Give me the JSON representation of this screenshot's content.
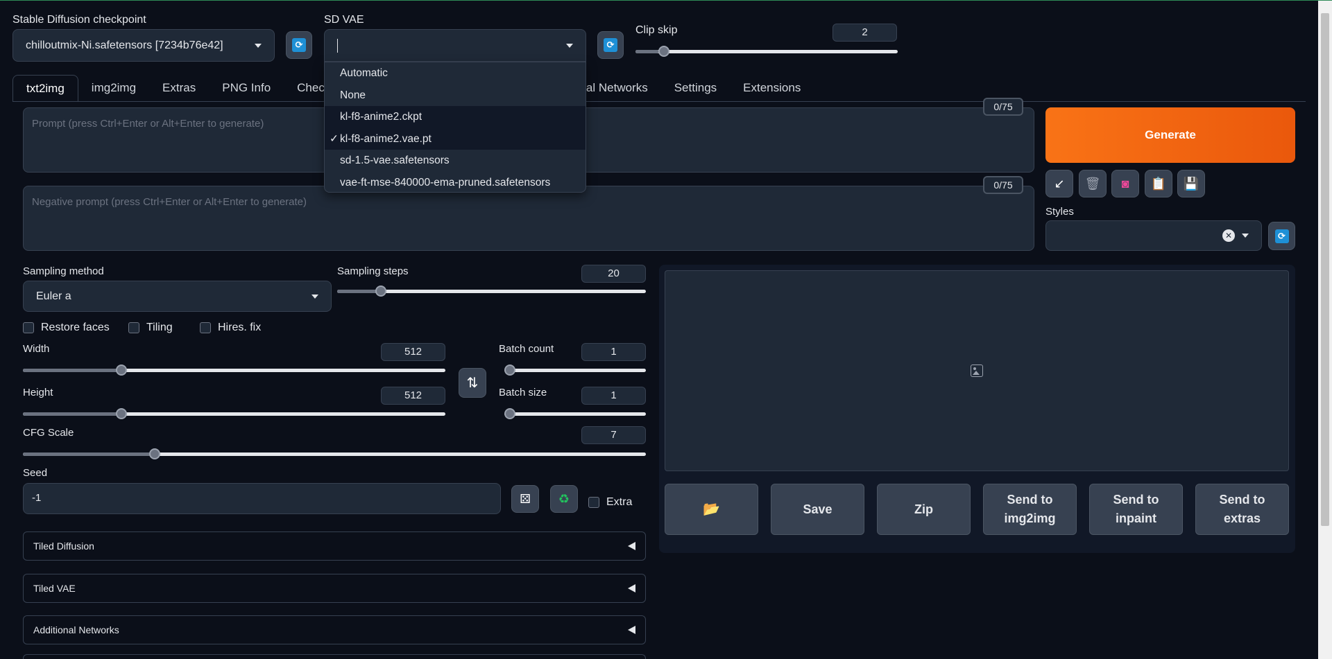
{
  "checkpoint": {
    "label": "Stable Diffusion checkpoint",
    "value": "chilloutmix-Ni.safetensors [7234b76e42]"
  },
  "vae": {
    "label": "SD VAE",
    "value": "",
    "options": [
      "Automatic",
      "None",
      "kl-f8-anime2.ckpt",
      "kl-f8-anime2.vae.pt",
      "sd-1.5-vae.safetensors",
      "vae-ft-mse-840000-ema-pruned.safetensors"
    ],
    "checkmark": "✓"
  },
  "clip_skip": {
    "label": "Clip skip",
    "value": "2",
    "min": 1,
    "max": 12,
    "level": 2
  },
  "tabs": [
    {
      "label": "txt2img"
    },
    {
      "label": "img2img"
    },
    {
      "label": "Extras"
    },
    {
      "label": "PNG Info"
    },
    {
      "label": "Check"
    },
    {
      "label": "onal Networks"
    },
    {
      "label": "Settings"
    },
    {
      "label": "Extensions"
    }
  ],
  "prompt": {
    "placeholder": "Prompt (press Ctrl+Enter or Alt+Enter to generate)",
    "tokens": "0/75"
  },
  "negative_prompt": {
    "placeholder": "Negative prompt (press Ctrl+Enter or Alt+Enter to generate)",
    "tokens": "0/75"
  },
  "generate_label": "Generate",
  "styles_label": "Styles",
  "clear_glyph": "✕",
  "sampling": {
    "method_label": "Sampling method",
    "method_value": "Euler a",
    "steps_label": "Sampling steps",
    "steps_value": "20",
    "steps_min": 1,
    "steps_max": 150,
    "steps": 20
  },
  "checkboxes": {
    "restore_faces": "Restore faces",
    "tiling": "Tiling",
    "hires_fix": "Hires. fix",
    "extra": "Extra"
  },
  "width": {
    "label": "Width",
    "value": "512",
    "min": 64,
    "max": 2048,
    "level": 512
  },
  "height": {
    "label": "Height",
    "value": "512",
    "min": 64,
    "max": 2048,
    "level": 512
  },
  "batch_count": {
    "label": "Batch count",
    "value": "1",
    "min": 1,
    "max": 100,
    "level": 1
  },
  "batch_size": {
    "label": "Batch size",
    "value": "1",
    "min": 1,
    "max": 8,
    "level": 1
  },
  "cfg": {
    "label": "CFG Scale",
    "value": "7",
    "min": 1,
    "max": 30,
    "level": 7
  },
  "seed": {
    "label": "Seed",
    "value": "-1"
  },
  "accordions": [
    "Tiled Diffusion",
    "Tiled VAE",
    "Additional Networks"
  ],
  "output_buttons": {
    "save": "Save",
    "zip": "Zip",
    "send_img2img": "Send to img2img",
    "send_inpaint": "Send to inpaint",
    "send_extras": "Send to extras"
  },
  "colors": {
    "accent": "#f97316",
    "background": "#0b0f19",
    "panel": "#1f2937",
    "refresh": "#1e90d6"
  }
}
